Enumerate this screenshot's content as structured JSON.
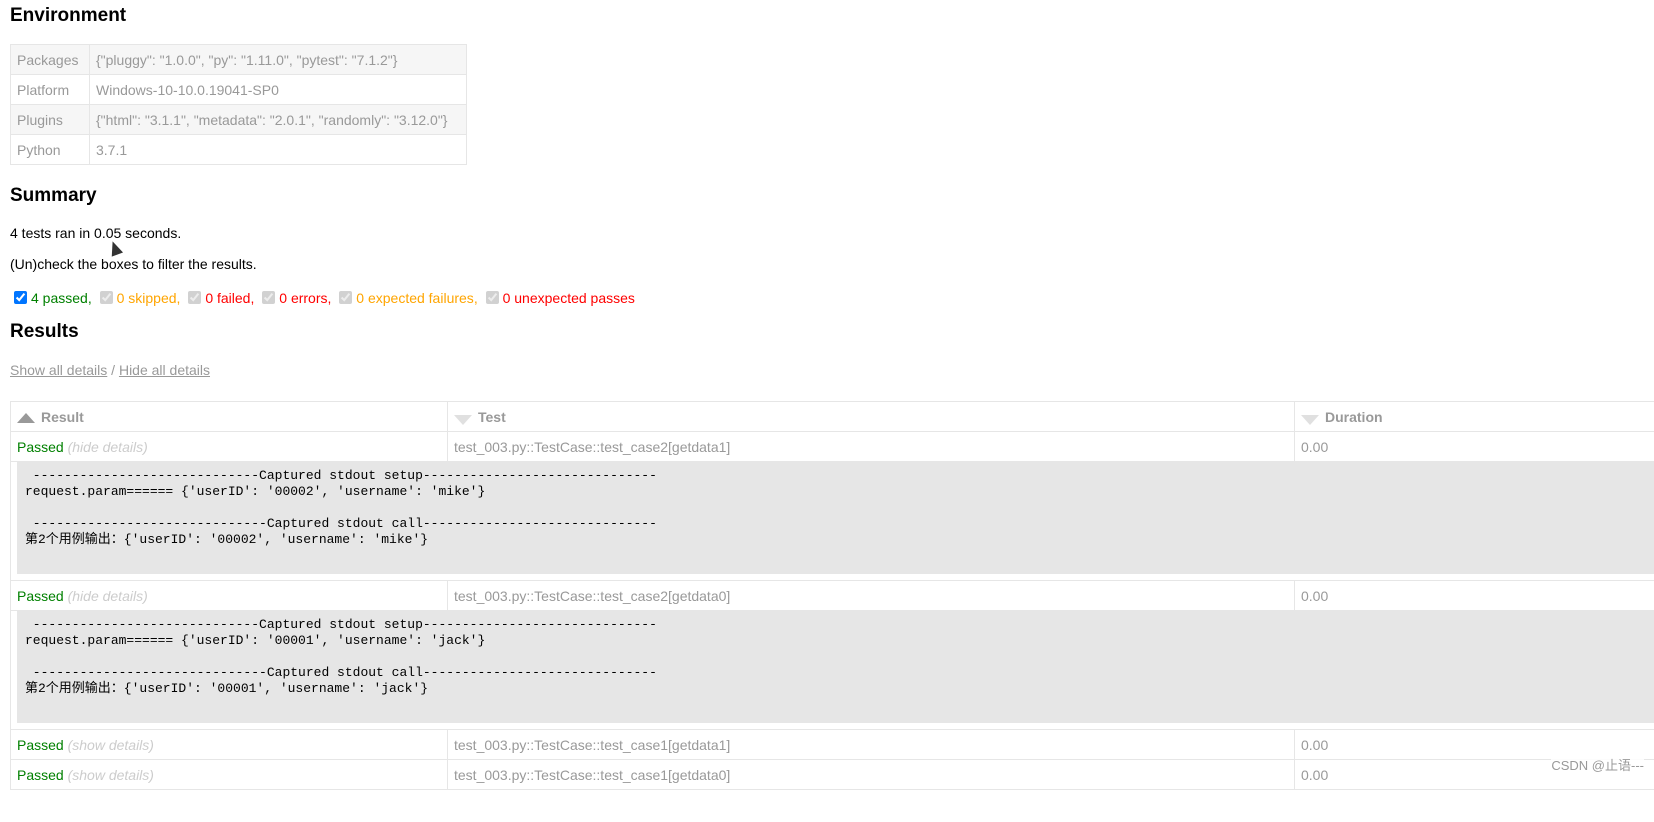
{
  "environment": {
    "heading": "Environment",
    "rows": [
      {
        "key": "Packages",
        "value": "{\"pluggy\": \"1.0.0\", \"py\": \"1.11.0\", \"pytest\": \"7.1.2\"}"
      },
      {
        "key": "Platform",
        "value": "Windows-10-10.0.19041-SP0"
      },
      {
        "key": "Plugins",
        "value": "{\"html\": \"3.1.1\", \"metadata\": \"2.0.1\", \"randomly\": \"3.12.0\"}"
      },
      {
        "key": "Python",
        "value": "3.7.1"
      }
    ]
  },
  "summary": {
    "heading": "Summary",
    "ran_text": "4 tests ran in 0.05 seconds.",
    "filter_hint": "(Un)check the boxes to filter the results.",
    "filters": [
      {
        "label": "4 passed",
        "sep": ",",
        "checked": true,
        "enabled": true,
        "kind": "passed"
      },
      {
        "label": "0 skipped",
        "sep": ",",
        "checked": true,
        "enabled": false,
        "kind": "skipped"
      },
      {
        "label": "0 failed",
        "sep": ",",
        "checked": true,
        "enabled": false,
        "kind": "failed"
      },
      {
        "label": "0 errors",
        "sep": ",",
        "checked": true,
        "enabled": false,
        "kind": "error"
      },
      {
        "label": "0 expected failures",
        "sep": ",",
        "checked": true,
        "enabled": false,
        "kind": "xfailed"
      },
      {
        "label": "0 unexpected passes",
        "sep": "",
        "checked": true,
        "enabled": false,
        "kind": "xpassed"
      }
    ]
  },
  "results": {
    "heading": "Results",
    "show_all": "Show all details",
    "sep": " / ",
    "hide_all": "Hide all details",
    "columns": {
      "result": "Result",
      "test": "Test",
      "duration": "Duration"
    },
    "rows": [
      {
        "result": "Passed",
        "toggle": "(hide details)",
        "test": "test_003.py::TestCase::test_case2[getdata1]",
        "duration": "0.00",
        "log": " -----------------------------Captured stdout setup------------------------------\nrequest.param====== {'userID': '00002', 'username': 'mike'}\n\n ------------------------------Captured stdout call------------------------------\n第2个用例输出：{'userID': '00002', 'username': 'mike'}"
      },
      {
        "result": "Passed",
        "toggle": "(hide details)",
        "test": "test_003.py::TestCase::test_case2[getdata0]",
        "duration": "0.00",
        "log": " -----------------------------Captured stdout setup------------------------------\nrequest.param====== {'userID': '00001', 'username': 'jack'}\n\n ------------------------------Captured stdout call------------------------------\n第2个用例输出：{'userID': '00001', 'username': 'jack'}"
      },
      {
        "result": "Passed",
        "toggle": "(show details)",
        "test": "test_003.py::TestCase::test_case1[getdata1]",
        "duration": "0.00",
        "log": null
      },
      {
        "result": "Passed",
        "toggle": "(show details)",
        "test": "test_003.py::TestCase::test_case1[getdata0]",
        "duration": "0.00",
        "log": null
      }
    ]
  },
  "watermark": "CSDN @止语---",
  "colors": {
    "passed": "#008000",
    "skipped": "#ffa500",
    "failed": "#ff0000",
    "log_bg": "#e6e6e6",
    "border": "#e6e6e6"
  }
}
